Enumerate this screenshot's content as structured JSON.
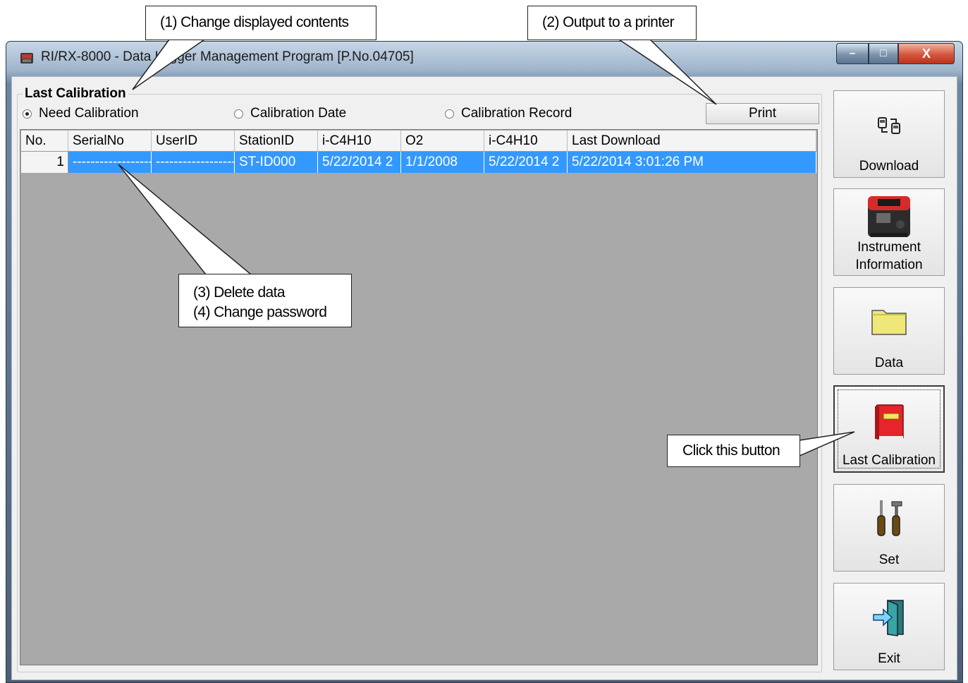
{
  "window": {
    "title": "RI/RX-8000  - Data Logger Management Program [P.No.04705]",
    "minimize_glyph": "–",
    "maximize_glyph": "□",
    "close_glyph": "X"
  },
  "group": {
    "title": "Last Calibration",
    "radios": [
      {
        "label": "Need Calibration",
        "selected": true
      },
      {
        "label": "Calibration Date",
        "selected": false
      },
      {
        "label": "Calibration Record",
        "selected": false
      }
    ],
    "print_label": "Print"
  },
  "table": {
    "columns": [
      "No.",
      "SerialNo",
      "UserID",
      "StationID",
      "i-C4H10",
      "O2",
      "i-C4H10",
      "Last Download"
    ],
    "rows": [
      [
        "1",
        "--------------------",
        "-------------------",
        "ST-ID000",
        "5/22/2014 2",
        "1/1/2008",
        "5/22/2014 2",
        "5/22/2014 3:01:26 PM"
      ]
    ]
  },
  "sidebar": {
    "buttons": [
      {
        "label": "Download",
        "icon": "download-icon"
      },
      {
        "label": "Instrument",
        "label2": "Information",
        "icon": "instrument-icon"
      },
      {
        "label": "Data",
        "icon": "folder-icon"
      },
      {
        "label": "Last Calibration",
        "icon": "calibration-book-icon"
      },
      {
        "label": "Set",
        "icon": "tools-icon"
      },
      {
        "label": "Exit",
        "icon": "exit-door-icon"
      }
    ]
  },
  "callouts": {
    "c1": "(1) Change displayed contents",
    "c2": "(2) Output to a printer",
    "c3_line1": "(3) Delete data",
    "c3_line2": "(4) Change password",
    "c4": "Click this button"
  },
  "colors": {
    "selection": "#3399ff",
    "grid_bg": "#a9a9a9"
  }
}
